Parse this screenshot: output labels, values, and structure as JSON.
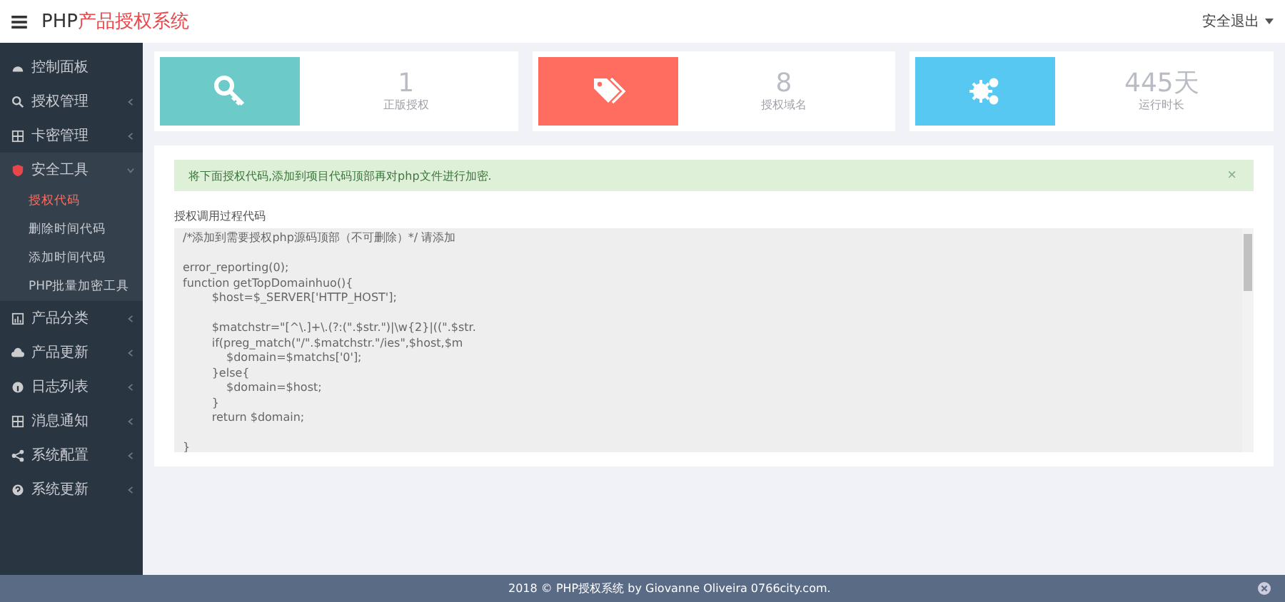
{
  "header": {
    "title_prefix": "PHP",
    "title_rest": "产品授权系统",
    "logout": "安全退出"
  },
  "sidebar": {
    "items": [
      {
        "label": "控制面板"
      },
      {
        "label": "授权管理",
        "expanded": false
      },
      {
        "label": "卡密管理",
        "expanded": false
      },
      {
        "label": "安全工具",
        "expanded": true,
        "children": [
          {
            "label": "授权代码",
            "selected": true
          },
          {
            "label": "删除时间代码",
            "selected": false
          },
          {
            "label": "添加时间代码",
            "selected": false
          },
          {
            "label": "PHP批量加密工具",
            "selected": false
          }
        ]
      },
      {
        "label": "产品分类",
        "expanded": false
      },
      {
        "label": "产品更新",
        "expanded": false
      },
      {
        "label": "日志列表",
        "expanded": false
      },
      {
        "label": "消息通知",
        "expanded": false
      },
      {
        "label": "系统配置",
        "expanded": false
      },
      {
        "label": "系统更新",
        "expanded": false
      }
    ]
  },
  "stats": [
    {
      "color": "#6ccac9",
      "value": "1",
      "label": "正版授权"
    },
    {
      "color": "#ff6c60",
      "value": "8",
      "label": "授权域名"
    },
    {
      "color": "#57c8f2",
      "value": "445天",
      "label": "运行时长"
    }
  ],
  "alert": {
    "text": "将下面授权代码,添加到项目代码顶部再对php文件进行加密.",
    "close": "×"
  },
  "code": {
    "label": "授权调用过程代码",
    "blocks": [
      [
        "/*添加到需要授权php源码顶部（不可删除）*/ 请添加"
      ],
      [
        "error_reporting(0);",
        "function getTopDomainhuo(){",
        "\t\t$host=$_SERVER['HTTP_HOST'];"
      ],
      [
        "\t\t$matchstr=\"[^\\.]+\\.(?:(\".$str.\")|\\w{2}|((\".$str.",
        "\t\tif(preg_match(\"/\".$matchstr.\"/ies\",$host,$m",
        "\t\t\t$domain=$matchs['0'];",
        "\t\t}else{",
        "\t\t\t$domain=$host;",
        "\t\t}",
        "\t\treturn $domain;"
      ],
      [
        "}"
      ]
    ]
  },
  "footer": {
    "text": "2018 © PHP授权系统 by Giovanne Oliveira 0766city.com."
  }
}
